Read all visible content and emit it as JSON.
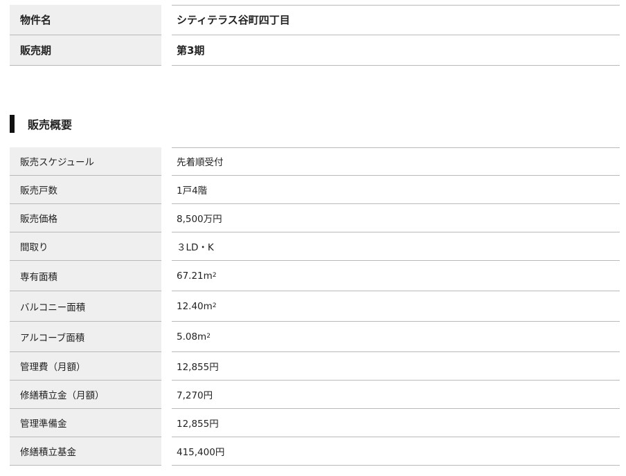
{
  "property": {
    "rows": [
      {
        "label": "物件名",
        "value": "シティテラス谷町四丁目"
      },
      {
        "label": "販売期",
        "value": "第3期"
      }
    ]
  },
  "summary": {
    "title": "販売概要",
    "rows": [
      {
        "label": "販売スケジュール",
        "value": "先着順受付"
      },
      {
        "label": "販売戸数",
        "value": "1戸4階"
      },
      {
        "label": "販売価格",
        "value": "8,500万円"
      },
      {
        "label": "間取り",
        "value": "３LD・K"
      },
      {
        "label": "専有面積",
        "value": "67.21m",
        "sup": "2"
      },
      {
        "label": "バルコニー面積",
        "value": "12.40m",
        "sup": "2"
      },
      {
        "label": "アルコーブ面積",
        "value": "5.08m",
        "sup": "2"
      },
      {
        "label": "管理費（月額）",
        "value": "12,855円"
      },
      {
        "label": "修繕積立金（月額）",
        "value": "7,270円"
      },
      {
        "label": "管理準備金",
        "value": "12,855円"
      },
      {
        "label": "修繕積立基金",
        "value": "415,400円"
      }
    ]
  }
}
